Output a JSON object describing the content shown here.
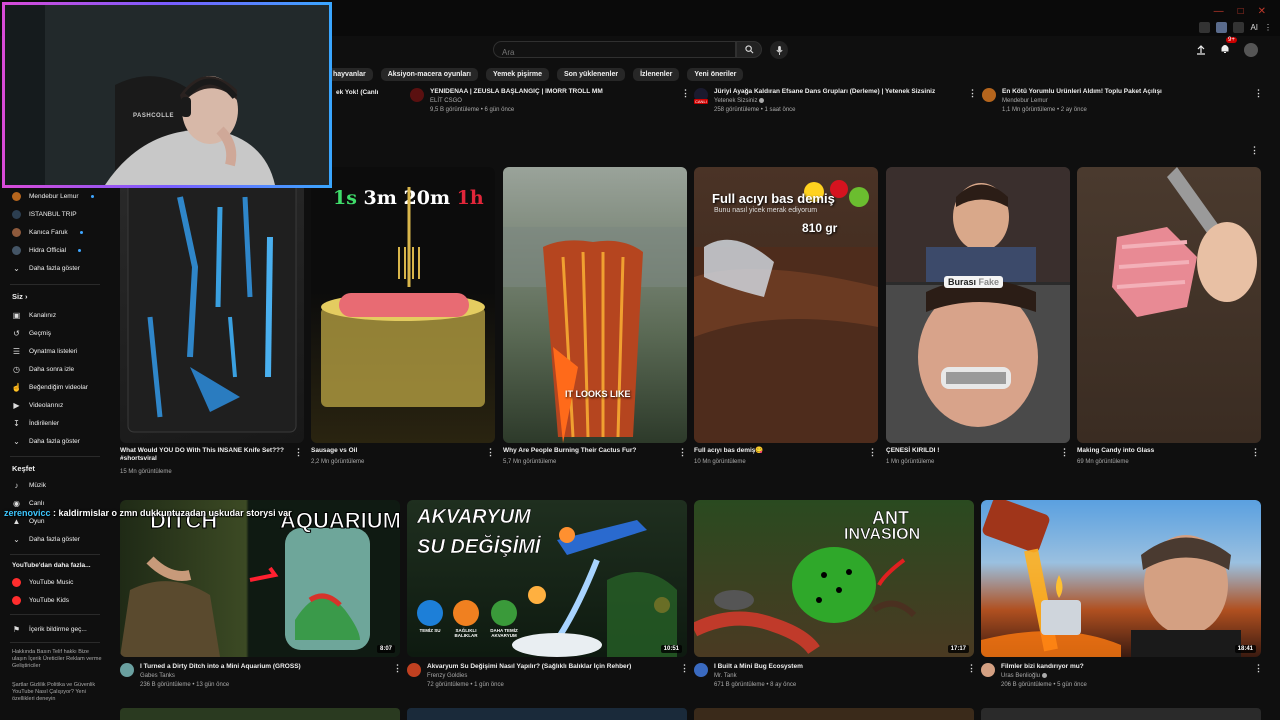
{
  "window": {
    "extensions_label": "AI"
  },
  "search": {
    "placeholder": "Ara"
  },
  "header": {
    "notification_count": "9+"
  },
  "chips": [
    "hayvanlar",
    "Aksiyon-macera oyunları",
    "Yemek pişirme",
    "Son yüklenenler",
    "İzlenenler",
    "Yeni öneriler"
  ],
  "sidebar": {
    "subscriptions": [
      {
        "name": "Mendebur Lemur",
        "color": "#b5651d",
        "new": true
      },
      {
        "name": "ISTANBUL TRIP",
        "color": "#2c3e50",
        "new": false
      },
      {
        "name": "Kanıca Faruk",
        "color": "#8e5a3c",
        "new": true
      },
      {
        "name": "Hidra Official",
        "color": "#445566",
        "new": true
      }
    ],
    "show_more_subs": "Daha fazla göster",
    "you_heading": "Siz",
    "you_items": [
      {
        "label": "Kanalınız",
        "icon": "channel-icon"
      },
      {
        "label": "Geçmiş",
        "icon": "history-icon"
      },
      {
        "label": "Oynatma listeleri",
        "icon": "playlists-icon"
      },
      {
        "label": "Daha sonra izle",
        "icon": "watch-later-icon"
      },
      {
        "label": "Beğendiğim videolar",
        "icon": "like-icon"
      },
      {
        "label": "Videolarınız",
        "icon": "your-videos-icon"
      },
      {
        "label": "İndirilenler",
        "icon": "downloads-icon"
      }
    ],
    "show_more_you": "Daha fazla göster",
    "explore_heading": "Keşfet",
    "explore_items": [
      {
        "label": "Müzik",
        "icon": "music-icon"
      },
      {
        "label": "Canlı",
        "icon": "live-icon"
      },
      {
        "label": "Oyun",
        "icon": "gaming-icon"
      }
    ],
    "show_more_explore": "Daha fazla göster",
    "more_yt_heading": "YouTube'dan daha fazla...",
    "more_yt_items": [
      {
        "label": "YouTube Music"
      },
      {
        "label": "YouTube Kids"
      }
    ],
    "report": "İçerik bildirme geç...",
    "footer1": "Hakkında  Basın  Telif hakkı  Bize ulaşın  İçerik Üreticiler  Reklam verme  Geliştiriciler",
    "footer2": "Şartlar  Gizlilik  Politika ve Güvenlik  YouTube Nasıl Çalışıyor?  Yeni özellikleri deneyin"
  },
  "top_row": [
    {
      "title": "ek Yok! (Canlı",
      "meta": ""
    },
    {
      "title": "YENİDENAA | ZEUSLA BAŞLANGIÇ | İMORR TROLL MM",
      "channel": "ELİT CSGO",
      "meta": "9,5 B görüntüleme • 6 gün önce"
    },
    {
      "title": "Jüriyi Ayağa Kaldıran Efsane Dans Grupları (Derleme) | Yetenek Sizsiniz",
      "channel": "Yetenek Sizsiniz",
      "meta": "258 görüntüleme • 1 saat önce",
      "badge": "CANLI"
    },
    {
      "title": "En Kötü Yorumlu Ürünleri Aldım! Toplu Paket Açılışı",
      "channel": "Mendebur Lemur",
      "meta": "1,1 Mn görüntüleme • 2 ay önce"
    }
  ],
  "shorts": [
    {
      "title": "What Would YOU DO With This INSANE Knife Set??? #shortsviral",
      "views": "15 Mn görüntüleme"
    },
    {
      "title": "Sausage vs Oil",
      "views": "2,2 Mn görüntüleme",
      "overlay_parts": [
        "1s",
        "3m",
        "20m",
        "1h"
      ]
    },
    {
      "title": "Why Are People Burning Their Cactus Fur?",
      "views": "5,7 Mn görüntüleme",
      "overlay": "IT LOOKS LIKE"
    },
    {
      "title": "Full acıyı bas demiş😋",
      "views": "10 Mn görüntüleme",
      "overlay_line1": "Full acıyı bas demiş",
      "overlay_line2": "Bunu nasıl yicek merak ediyorum",
      "overlay_weight": "810 gr"
    },
    {
      "title": "ÇENESİ KIRILDI !",
      "views": "1 Mn görüntüleme",
      "overlay_a": "Burası",
      "overlay_b": "Fake"
    },
    {
      "title": "Making Candy into Glass",
      "views": "69 Mn görüntüleme"
    }
  ],
  "videos": [
    {
      "title": "I Turned a Dirty Ditch into a Mini Aquarium (GROSS)",
      "channel": "Gabes Tanks",
      "meta": "236 B görüntüleme • 13 gün önce",
      "duration": "8:07",
      "thumb_text_a": "DITCH",
      "thumb_text_b": "AQUARIUM",
      "verified": false
    },
    {
      "title": "Akvaryum Su Değişimi Nasıl Yapılır? (Sağlıklı Balıklar İçin Rehber)",
      "channel": "Frenzy Goldies",
      "meta": "72 görüntüleme • 1 gün önce",
      "duration": "10:51",
      "thumb_text_a": "AKVARYUM",
      "thumb_text_b": "SU DEĞİŞİMİ",
      "badges": [
        "TEMİZ SU",
        "SAĞLIKLI BALIKLAR",
        "DAHA TEMİZ AKVARYUM"
      ],
      "verified": false
    },
    {
      "title": "I Built a Mini Bug Ecosystem",
      "channel": "Mr. Tank",
      "meta": "671 B görüntüleme • 8 ay önce",
      "duration": "17:17",
      "thumb_text_a": "ANT",
      "thumb_text_b": "INVASION",
      "verified": false
    },
    {
      "title": "Filmler bizi kandırıyor mu?",
      "channel": "Uras Benlioğlu",
      "meta": "206 B görüntüleme • 5 gün önce",
      "duration": "18:41",
      "verified": true
    }
  ],
  "chat": {
    "user": "zerenovicc",
    "message": " : kaldirmislar o zmn dukkuntuzadan uskudar storysi var"
  },
  "webcam": {
    "chair_text": "PASHCOLLE"
  },
  "colors": {
    "accent_red": "#cc0000",
    "chat_user": "#3ec7ff",
    "webcam_border_start": "#d84bd8",
    "webcam_border_end": "#3aa6ff"
  }
}
